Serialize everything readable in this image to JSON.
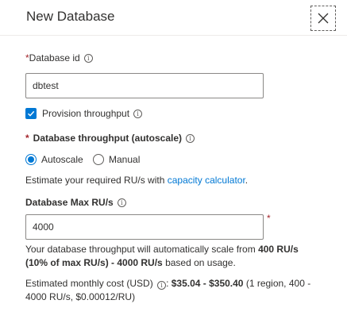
{
  "header": {
    "title": "New Database"
  },
  "database_id": {
    "required_mark": "*",
    "label": "Database id",
    "value": "dbtest"
  },
  "provision": {
    "label": "Provision throughput",
    "checked": true
  },
  "throughput": {
    "required_mark": "*",
    "title": "Database throughput (autoscale)",
    "options": [
      "Autoscale",
      "Manual"
    ],
    "selected": "Autoscale"
  },
  "estimate": {
    "text_before": "Estimate your required RU/s with ",
    "link_text": "capacity calculator",
    "text_after": "."
  },
  "max_rus": {
    "label": "Database Max RU/s",
    "value": "4000",
    "required_mark": "*"
  },
  "scale_note": {
    "part1": "Your database throughput will automatically scale from ",
    "bold1": "400 RU/s",
    "bold2": "(10% of max RU/s) - 4000 RU/s",
    "part2": " based on usage."
  },
  "cost": {
    "label": "Estimated monthly cost (USD)",
    "range": "$35.04 - $350.40",
    "detail1": " (1 region, 400 -",
    "detail2": "4000 RU/s, $0.00012/RU)"
  },
  "icons": {
    "close": "close-icon",
    "info": "info-icon",
    "checkmark": "checkmark-icon"
  },
  "colors": {
    "accent": "#0078d4",
    "required": "#a4262c"
  }
}
